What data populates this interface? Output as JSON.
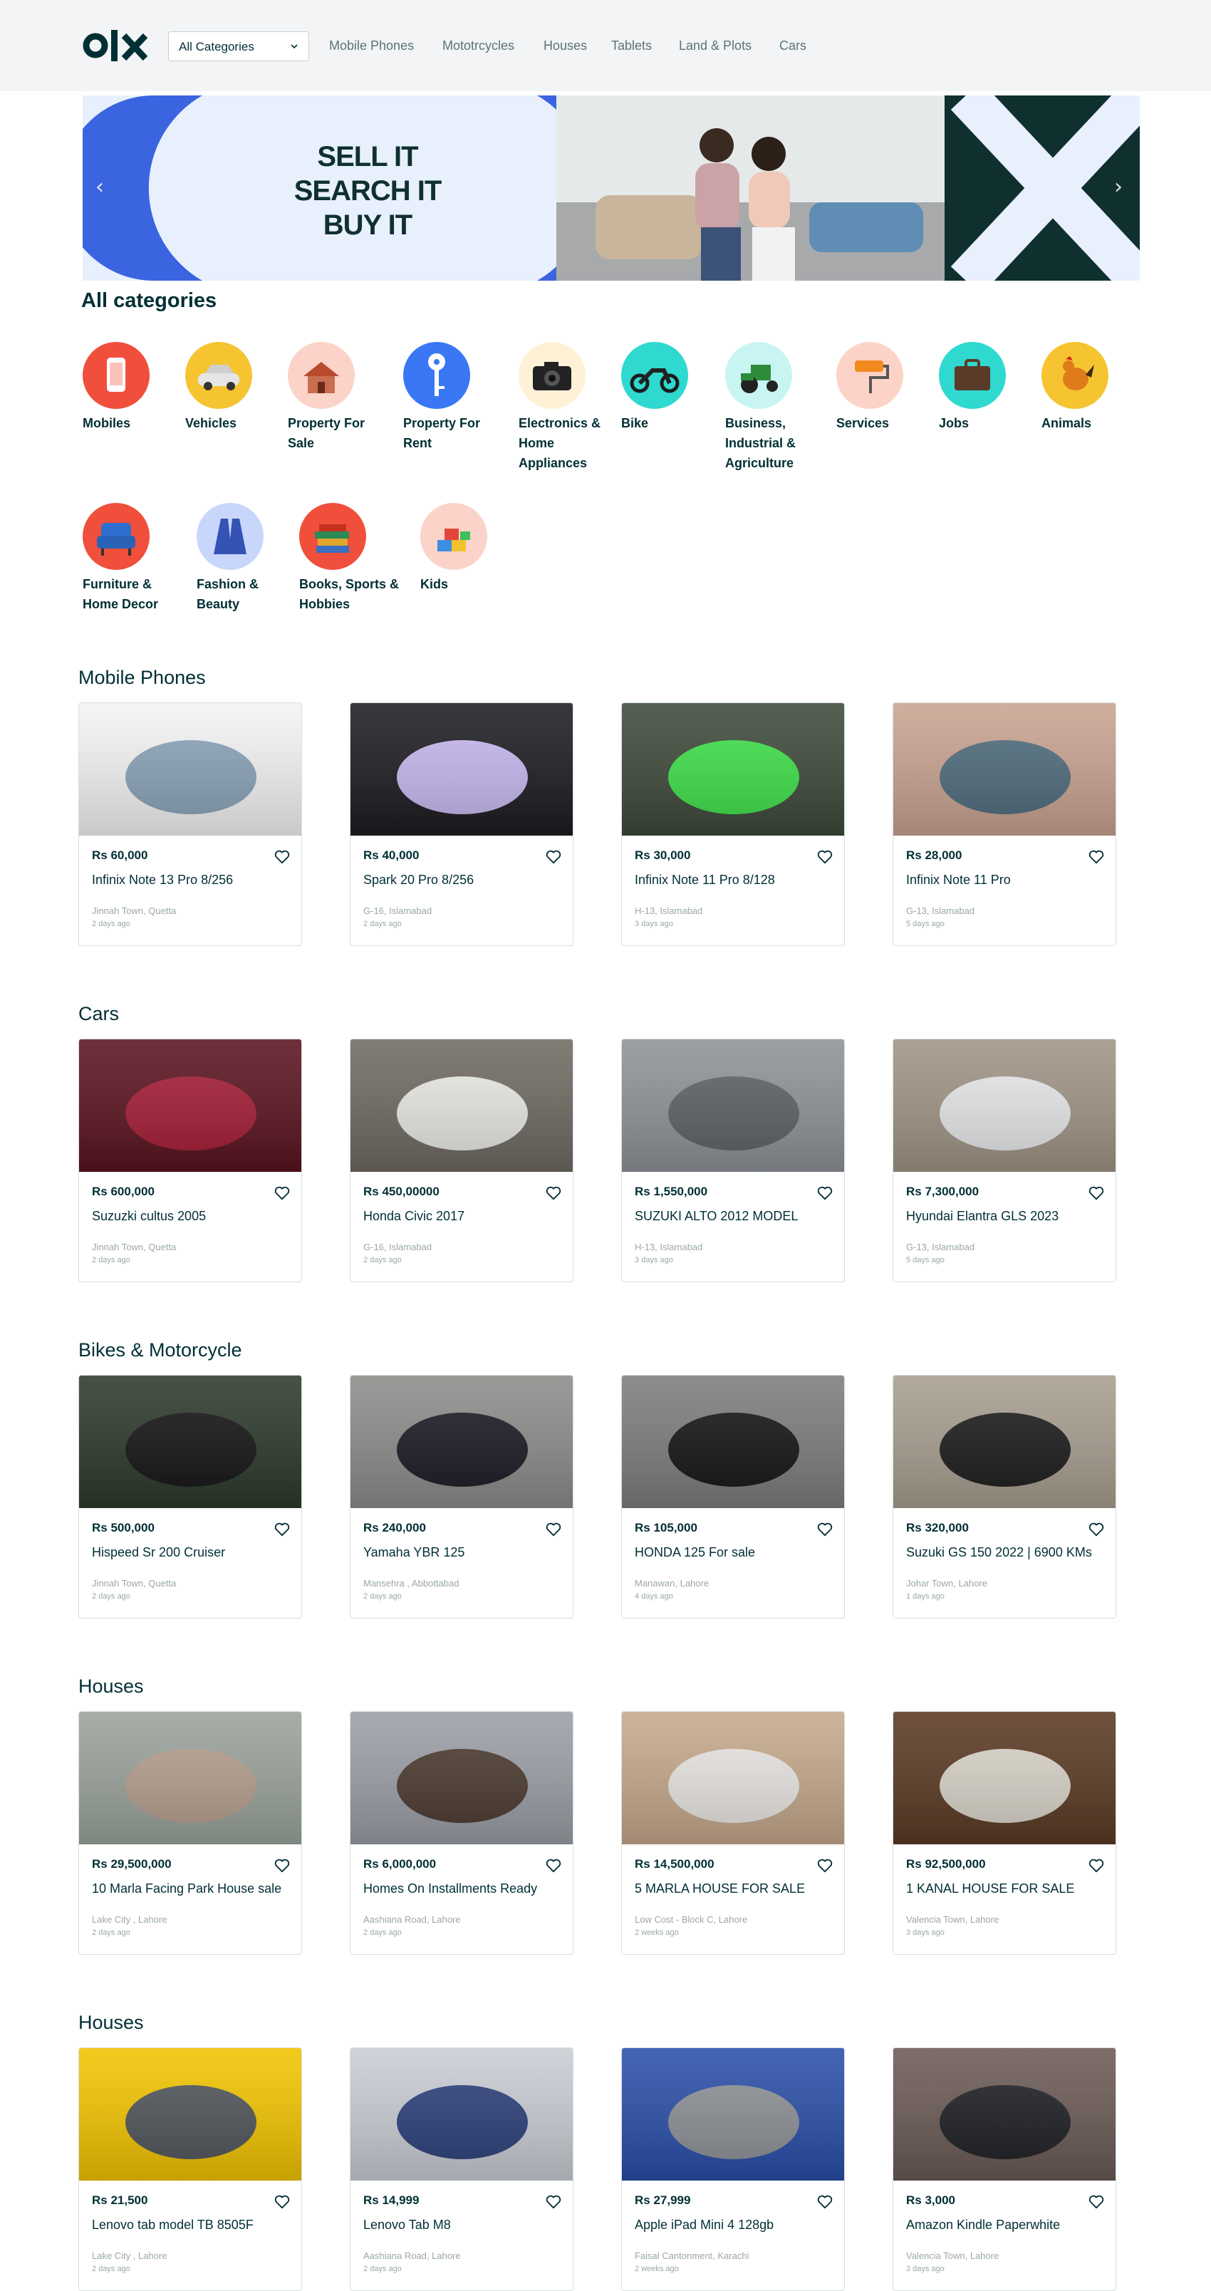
{
  "header": {
    "category_select": "All Categories",
    "nav_links": [
      "Mobile Phones",
      "Mototrcycles",
      "Houses",
      "Tablets",
      "Land & Plots",
      "Cars"
    ]
  },
  "banner": {
    "lines": [
      "SELL IT",
      "SEARCH IT",
      "BUY IT"
    ],
    "prev_arrow": "‹",
    "next_arrow": "›"
  },
  "categories": {
    "heading": "All categories",
    "items": [
      {
        "label": "Mobiles",
        "color": "#f04f3c",
        "icon": "phone-icon"
      },
      {
        "label": "Vehicles",
        "color": "#f6c431",
        "icon": "car-icon"
      },
      {
        "label": "Property For Sale",
        "color": "#fbd3c8",
        "icon": "house-icon"
      },
      {
        "label": "Property For Rent",
        "color": "#3a77f5",
        "icon": "key-icon"
      },
      {
        "label": "Electronics & Home Appliances",
        "color": "#fff1d6",
        "icon": "camera-icon"
      },
      {
        "label": "Bike",
        "color": "#2fd9cf",
        "icon": "motorbike-icon"
      },
      {
        "label": "Business, Industrial & Agriculture",
        "color": "#c8f5f2",
        "icon": "tractor-icon"
      },
      {
        "label": "Services",
        "color": "#fdd3c8",
        "icon": "paint-roller-icon"
      },
      {
        "label": "Jobs",
        "color": "#2fd9cf",
        "icon": "briefcase-icon"
      },
      {
        "label": "Animals",
        "color": "#f6c431",
        "icon": "rooster-icon"
      },
      {
        "label": "Furniture & Home Decor",
        "color": "#f04f3c",
        "icon": "armchair-icon"
      },
      {
        "label": "Fashion & Beauty",
        "color": "#c8d6fb",
        "icon": "robe-icon"
      },
      {
        "label": "Books, Sports & Hobbies",
        "color": "#f04f3c",
        "icon": "books-icon"
      },
      {
        "label": "Kids",
        "color": "#fbd3c8",
        "icon": "blocks-icon"
      }
    ]
  },
  "sections": [
    {
      "title": "Mobile Phones",
      "cards": [
        {
          "price": "Rs 60,000",
          "title": "Infinix Note 13 Pro 8/256",
          "location": "Jinnah Town, Quetta",
          "date": "2 days ago",
          "img_bg": "#f4f4f4",
          "img_fg": "#8aa3b8"
        },
        {
          "price": "Rs 40,000",
          "title": "Spark 20 Pro 8/256",
          "location": "G-16, Islamabad",
          "date": "2 days ago",
          "img_bg": "#1c1c22",
          "img_fg": "#c7b8f0"
        },
        {
          "price": "Rs 30,000",
          "title": "Infinix Note 11 Pro 8/128",
          "location": "H-13, Islamabad",
          "date": "3 days ago",
          "img_bg": "#3e4a3a",
          "img_fg": "#3fe04a"
        },
        {
          "price": "Rs 28,000",
          "title": "Infinix Note 11 Pro",
          "location": "G-13, Islamabad",
          "date": "5 days ago",
          "img_bg": "#c9a391",
          "img_fg": "#4f6c7d"
        }
      ]
    },
    {
      "title": "Cars",
      "cards": [
        {
          "price": "Rs 600,000",
          "title": "Suzuzki cultus 2005",
          "location": "Jinnah Town, Quetta",
          "date": "2 days ago",
          "img_bg": "#5a1420",
          "img_fg": "#a51d35"
        },
        {
          "price": "Rs 450,00000",
          "title": "Honda Civic 2017",
          "location": "G-16, Islamabad",
          "date": "2 days ago",
          "img_bg": "#6f6a62",
          "img_fg": "#e8e8e4"
        },
        {
          "price": "Rs 1,550,000",
          "title": "SUZUKI ALTO 2012 MODEL",
          "location": "H-13, Islamabad",
          "date": "3 days ago",
          "img_bg": "#8e9398",
          "img_fg": "#5c6266"
        },
        {
          "price": "Rs 7,300,000",
          "title": "Hyundai Elantra GLS 2023",
          "location": "G-13, Islamabad",
          "date": "5 days ago",
          "img_bg": "#a09485",
          "img_fg": "#e6e8ea"
        }
      ]
    },
    {
      "title": "Bikes & Motorcycle",
      "cards": [
        {
          "price": "Rs 500,000",
          "title": "Hispeed Sr 200 Cruiser",
          "location": "Jinnah Town, Quetta",
          "date": "2 days ago",
          "img_bg": "#2c3a2c",
          "img_fg": "#141414"
        },
        {
          "price": "Rs 240,000",
          "title": "Yamaha YBR 125",
          "location": "Mansehra , Abbottabad",
          "date": "2 days ago",
          "img_bg": "#8d8c8a",
          "img_fg": "#1a1a24"
        },
        {
          "price": "Rs 105,000",
          "title": "HONDA 125 For sale",
          "location": "Manawan, Lahore",
          "date": "4 days ago",
          "img_bg": "#7b7e7c",
          "img_fg": "#151515"
        },
        {
          "price": "Rs 320,000",
          "title": "Suzuki GS 150 2022 | 6900 KMs",
          "location": "Johar Town, Lahore",
          "date": "1 days ago",
          "img_bg": "#a89e90",
          "img_fg": "#1c1c1c"
        }
      ]
    },
    {
      "title": "Houses",
      "cards": [
        {
          "price": "Rs 29,500,000",
          "title": "10 Marla Facing Park House sale",
          "location": "Lake City , Lahore",
          "date": "2 days ago",
          "img_bg": "#9aa39b",
          "img_fg": "#b59f8e"
        },
        {
          "price": "Rs 6,000,000",
          "title": "Homes On Installments Ready",
          "location": "Aashiana Road, Lahore",
          "date": "2 days ago",
          "img_bg": "#9b9fa6",
          "img_fg": "#4b3a30"
        },
        {
          "price": "Rs 14,500,000",
          "title": "5 MARLA HOUSE FOR SALE",
          "location": "Low Cost - Block C, Lahore",
          "date": "2 weeks ago",
          "img_bg": "#c5a98c",
          "img_fg": "#e9e6e2"
        },
        {
          "price": "Rs 92,500,000",
          "title": "1 KANAL HOUSE FOR SALE",
          "location": "Valencia Town, Lahore",
          "date": "3 days ago",
          "img_bg": "#5a3a24",
          "img_fg": "#d9d4c9"
        }
      ]
    },
    {
      "title": "Houses",
      "cards": [
        {
          "price": "Rs 21,500",
          "title": "Lenovo tab model TB 8505F",
          "location": "Lake City , Lahore",
          "date": "2 days ago",
          "img_bg": "#f2c400",
          "img_fg": "#50555a"
        },
        {
          "price": "Rs 14,999",
          "title": "Lenovo Tab M8",
          "location": "Aashiana Road, Lahore",
          "date": "2 days ago",
          "img_bg": "#c9cdd4",
          "img_fg": "#2c3f7a"
        },
        {
          "price": "Rs 27,999",
          "title": "Apple iPad Mini 4 128gb",
          "location": "Faisal Cantonment, Karachi",
          "date": "2 weeks ago",
          "img_bg": "#2a4fa8",
          "img_fg": "#8d9096"
        },
        {
          "price": "Rs 3,000",
          "title": "Amazon Kindle Paperwhite",
          "location": "Valencia Town, Lahore",
          "date": "3 days ago",
          "img_bg": "#6b5a55",
          "img_fg": "#1d1f24"
        }
      ]
    }
  ]
}
